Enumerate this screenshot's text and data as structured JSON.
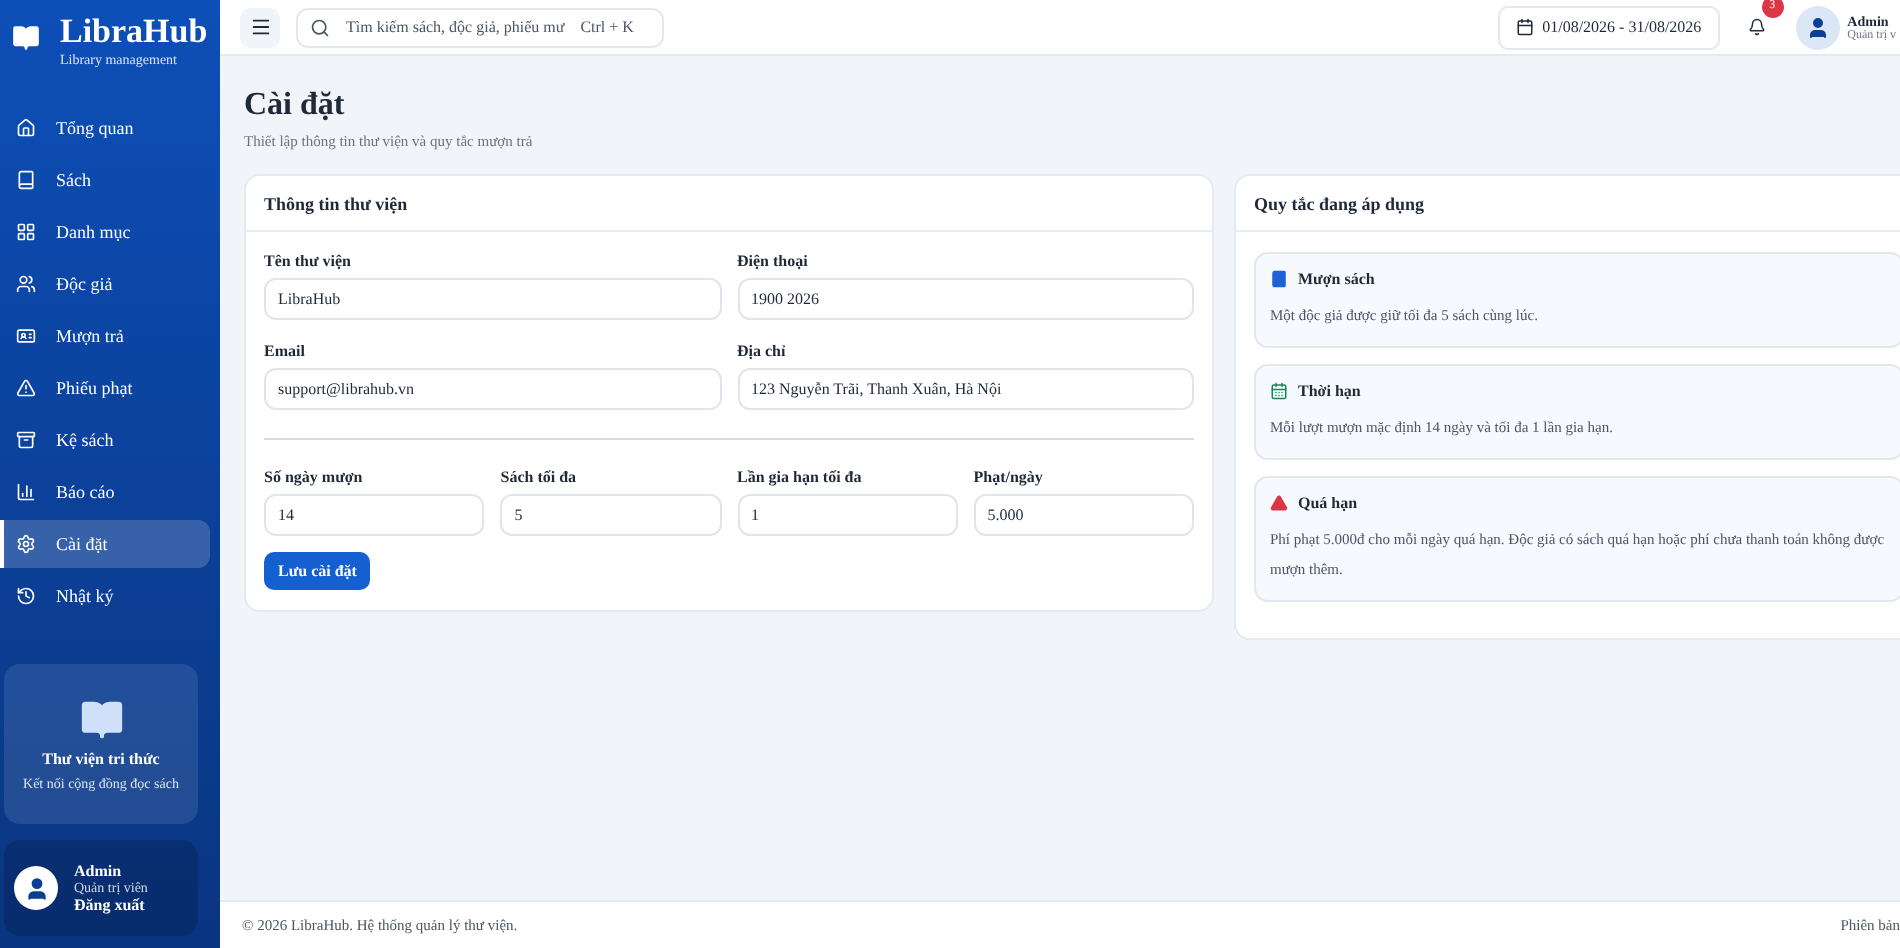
{
  "sidebar": {
    "brand": {
      "name": "LibraHub",
      "tagline": "Library management"
    },
    "items": [
      {
        "label": "Tổng quan",
        "selected": false
      },
      {
        "label": "Sách",
        "selected": false
      },
      {
        "label": "Danh mục",
        "selected": false
      },
      {
        "label": "Độc giả",
        "selected": false
      },
      {
        "label": "Mượn trả",
        "selected": false
      },
      {
        "label": "Phiếu phạt",
        "selected": false
      },
      {
        "label": "Kệ sách",
        "selected": false
      },
      {
        "label": "Báo cáo",
        "selected": false
      },
      {
        "label": "Cài đặt",
        "selected": true
      },
      {
        "label": "Nhật ký",
        "selected": false
      }
    ],
    "promo": {
      "title": "Thư viện tri thức",
      "subtitle": "Kết nối cộng đồng đọc sách"
    },
    "user": {
      "name": "Admin",
      "role": "Quản trị viên",
      "action": "Đăng xuất"
    }
  },
  "topbar": {
    "search": {
      "placeholder": "Tìm kiếm sách, độc giả, phiếu mư",
      "shortcut": "Ctrl + K"
    },
    "date_range": "01/08/2026 - 31/08/2026",
    "notifications": {
      "count": "3"
    },
    "user": {
      "name": "Admin",
      "role": "Quản trị v"
    }
  },
  "page": {
    "title": "Cài đặt",
    "subtitle": "Thiết lập thông tin thư viện và quy tắc mượn trả"
  },
  "library_card": {
    "title": "Thông tin thư viện",
    "fields": [
      {
        "label": "Tên thư viện",
        "value": "LibraHub"
      },
      {
        "label": "Điện thoại",
        "value": "1900 2026"
      },
      {
        "label": "Email",
        "value": "support@librahub.vn"
      },
      {
        "label": "Địa chỉ",
        "value": "123 Nguyễn Trãi, Thanh Xuân, Hà Nội"
      }
    ],
    "rule_fields": [
      {
        "label": "Số ngày mượn",
        "value": "14"
      },
      {
        "label": "Sách tối đa",
        "value": "5"
      },
      {
        "label": "Lần gia hạn tối đa",
        "value": "1"
      },
      {
        "label": "Phạt/ngày",
        "value": "5.000"
      }
    ],
    "save_button": "Lưu cài đặt"
  },
  "rules_card": {
    "title": "Quy tắc đang áp dụng",
    "rules": [
      {
        "kind": "borrow",
        "title": "Mượn sách",
        "text": "Một độc giả được giữ tối đa 5 sách cùng lúc."
      },
      {
        "kind": "period",
        "title": "Thời hạn",
        "text": "Mỗi lượt mượn mặc định 14 ngày và tối đa 1 lần gia hạn."
      },
      {
        "kind": "overdue",
        "title": "Quá hạn",
        "text": "Phí phạt 5.000đ cho mỗi ngày quá hạn. Độc giả có sách quá hạn hoặc phí chưa thanh toán không được mượn thêm."
      }
    ]
  },
  "footer": {
    "copyright": "© 2026 LibraHub. Hệ thống quản lý thư viện.",
    "version": "Phiên bản"
  }
}
